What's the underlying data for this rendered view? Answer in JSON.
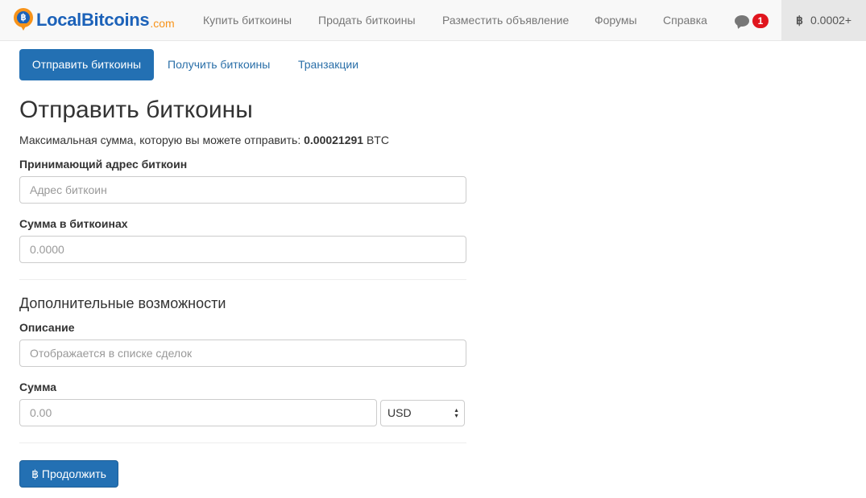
{
  "navbar": {
    "logo": {
      "name": "LocalBitcoins",
      "suffix": ".com",
      "icon": "bitcoin-location-pin-icon"
    },
    "links": [
      {
        "label": "Купить биткоины"
      },
      {
        "label": "Продать биткоины"
      },
      {
        "label": "Разместить объявление"
      },
      {
        "label": "Форумы"
      },
      {
        "label": "Справка"
      }
    ],
    "messages": {
      "icon": "chat-bubble-icon",
      "count": "1"
    },
    "balance": {
      "symbol": "฿",
      "value": "0.0002+"
    }
  },
  "tabs": [
    {
      "label": "Отправить биткоины",
      "active": true
    },
    {
      "label": "Получить биткоины",
      "active": false
    },
    {
      "label": "Транзакции",
      "active": false
    }
  ],
  "page": {
    "title": "Отправить биткоины",
    "max_text": "Максимальная сумма, которую вы можете отправить: ",
    "max_value": "0.00021291",
    "max_unit": " BTC"
  },
  "form": {
    "address_label": "Принимающий адрес биткоин",
    "address_placeholder": "Адрес биткоин",
    "amount_label": "Сумма в биткоинах",
    "amount_placeholder": "0.0000",
    "extra_heading": "Дополнительные возможности",
    "description_label": "Описание",
    "description_placeholder": "Отображается в списке сделок",
    "fiat_label": "Сумма",
    "fiat_placeholder": "0.00",
    "currency_selected": "USD",
    "submit_label": "฿ Продолжить"
  },
  "colors": {
    "primary": "#2370b3",
    "link": "#2a6fa8",
    "badge": "#e0151e",
    "brand_orange": "#f7931a",
    "brand_blue": "#1c62b9"
  }
}
